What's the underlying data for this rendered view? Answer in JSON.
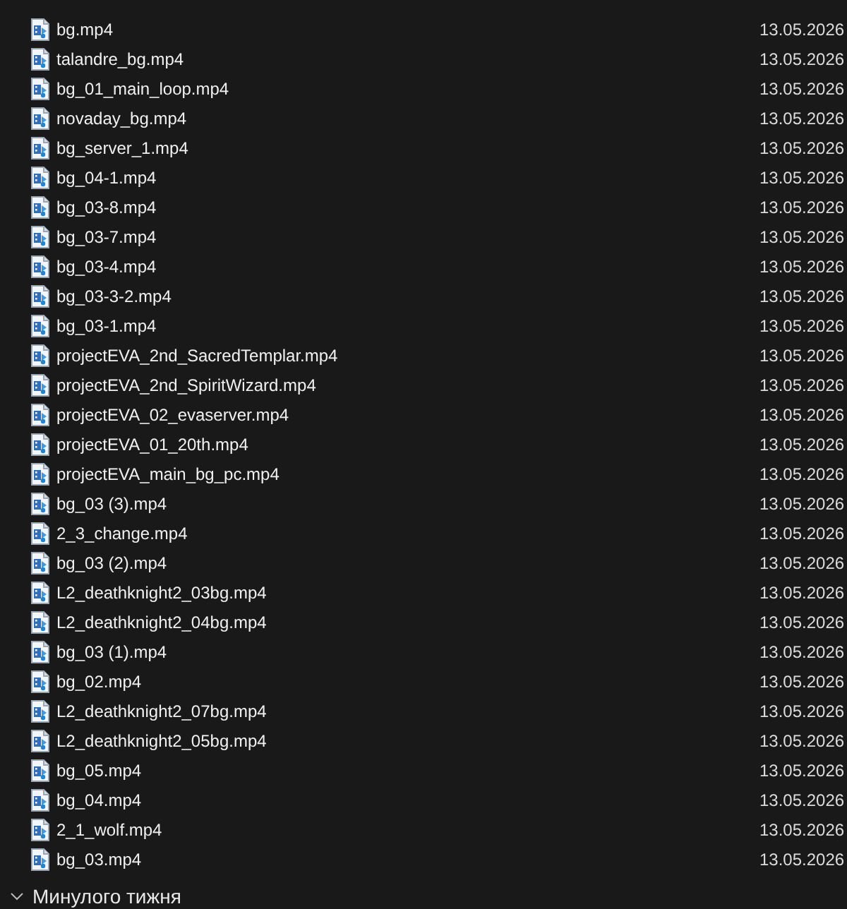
{
  "files": [
    {
      "name": "bg.mp4",
      "date": "13.05.2026"
    },
    {
      "name": "talandre_bg.mp4",
      "date": "13.05.2026"
    },
    {
      "name": "bg_01_main_loop.mp4",
      "date": "13.05.2026"
    },
    {
      "name": "novaday_bg.mp4",
      "date": "13.05.2026"
    },
    {
      "name": "bg_server_1.mp4",
      "date": "13.05.2026"
    },
    {
      "name": "bg_04-1.mp4",
      "date": "13.05.2026"
    },
    {
      "name": "bg_03-8.mp4",
      "date": "13.05.2026"
    },
    {
      "name": "bg_03-7.mp4",
      "date": "13.05.2026"
    },
    {
      "name": "bg_03-4.mp4",
      "date": "13.05.2026"
    },
    {
      "name": "bg_03-3-2.mp4",
      "date": "13.05.2026"
    },
    {
      "name": "bg_03-1.mp4",
      "date": "13.05.2026"
    },
    {
      "name": "projectEVA_2nd_SacredTemplar.mp4",
      "date": "13.05.2026"
    },
    {
      "name": "projectEVA_2nd_SpiritWizard.mp4",
      "date": "13.05.2026"
    },
    {
      "name": "projectEVA_02_evaserver.mp4",
      "date": "13.05.2026"
    },
    {
      "name": "projectEVA_01_20th.mp4",
      "date": "13.05.2026"
    },
    {
      "name": "projectEVA_main_bg_pc.mp4",
      "date": "13.05.2026"
    },
    {
      "name": "bg_03 (3).mp4",
      "date": "13.05.2026"
    },
    {
      "name": "2_3_change.mp4",
      "date": "13.05.2026"
    },
    {
      "name": "bg_03 (2).mp4",
      "date": "13.05.2026"
    },
    {
      "name": "L2_deathknight2_03bg.mp4",
      "date": "13.05.2026"
    },
    {
      "name": "L2_deathknight2_04bg.mp4",
      "date": "13.05.2026"
    },
    {
      "name": "bg_03 (1).mp4",
      "date": "13.05.2026"
    },
    {
      "name": "bg_02.mp4",
      "date": "13.05.2026"
    },
    {
      "name": "L2_deathknight2_07bg.mp4",
      "date": "13.05.2026"
    },
    {
      "name": "L2_deathknight2_05bg.mp4",
      "date": "13.05.2026"
    },
    {
      "name": "bg_05.mp4",
      "date": "13.05.2026"
    },
    {
      "name": "bg_04.mp4",
      "date": "13.05.2026"
    },
    {
      "name": "2_1_wolf.mp4",
      "date": "13.05.2026"
    },
    {
      "name": "bg_03.mp4",
      "date": "13.05.2026"
    }
  ],
  "next_group": {
    "title": "Минулого тижня",
    "expanded": true
  }
}
